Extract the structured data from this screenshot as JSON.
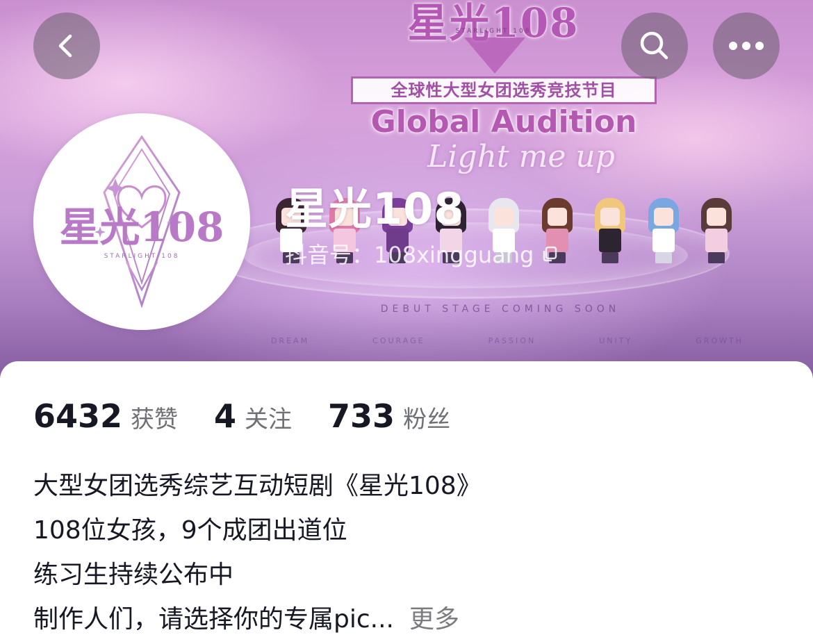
{
  "banner": {
    "logo_title": "星光108",
    "logo_subtitle": "STARLIGHT 108",
    "headline_cn": "全球性大型女团选秀竞技节目",
    "headline_en": "Global Audition",
    "script_text": "Light me up",
    "footer_text": "DEBUT STAGE COMING SOON",
    "footer_words": [
      "DREAM",
      "COURAGE",
      "PASSION",
      "UNITY",
      "GROWTH"
    ]
  },
  "nav": {
    "back_icon": "chevron-left-icon",
    "search_icon": "search-icon",
    "more_icon": "more-dots-icon"
  },
  "avatar": {
    "logo_title": "星光108",
    "logo_subtitle": "STARLIGHT 108"
  },
  "profile": {
    "name": "星光108",
    "id_text": "抖音号：108xingguang"
  },
  "stats": [
    {
      "value": "6432",
      "label": "获赞"
    },
    {
      "value": "4",
      "label": "关注"
    },
    {
      "value": "733",
      "label": "粉丝"
    }
  ],
  "bio": {
    "lines": [
      "大型女团选秀综艺互动短剧《星光108》",
      "108位女孩，9个成团出道位",
      "练习生持续公布中",
      "制作人们，请选择你的专属pic..."
    ],
    "more_label": "更多"
  },
  "colors": {
    "accent_pink": "#b458b2",
    "text_primary": "#161823",
    "text_secondary": "#6f7075"
  }
}
